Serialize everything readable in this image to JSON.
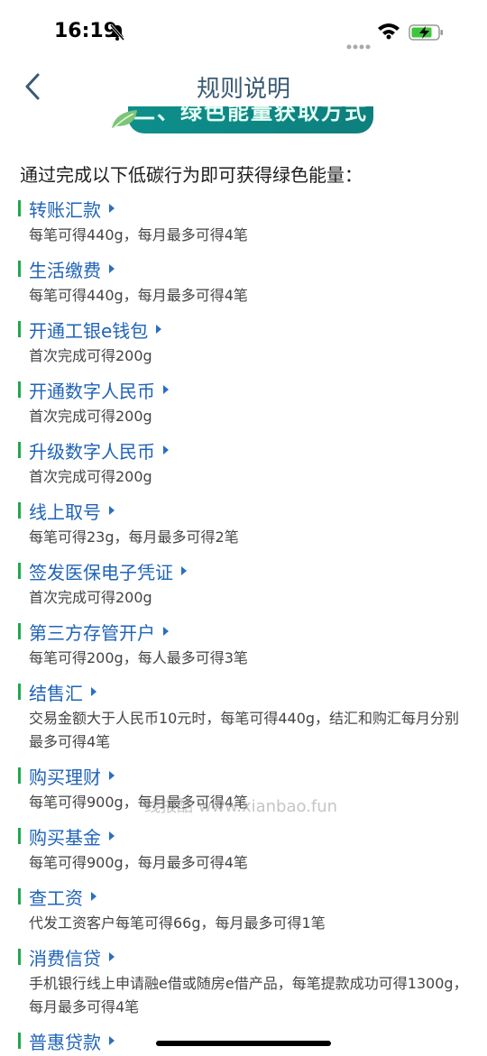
{
  "status": {
    "time": "16:19"
  },
  "nav": {
    "title": "规则说明"
  },
  "banner": {
    "text": "二、绿色能量获取方式"
  },
  "intro": "通过完成以下低碳行为即可获得绿色能量：",
  "items": [
    {
      "title": "转账汇款",
      "desc": "每笔可得440g，每月最多可得4笔"
    },
    {
      "title": "生活缴费",
      "desc": "每笔可得440g，每月最多可得4笔"
    },
    {
      "title": "开通工银e钱包",
      "desc": "首次完成可得200g"
    },
    {
      "title": "开通数字人民币",
      "desc": "首次完成可得200g"
    },
    {
      "title": "升级数字人民币",
      "desc": "首次完成可得200g"
    },
    {
      "title": "线上取号",
      "desc": "每笔可得23g，每月最多可得2笔"
    },
    {
      "title": "签发医保电子凭证",
      "desc": "首次完成可得200g"
    },
    {
      "title": "第三方存管开户",
      "desc": "每笔可得200g，每人最多可得3笔"
    },
    {
      "title": "结售汇",
      "desc": "交易金额大于人民币10元时，每笔可得440g，结汇和购汇每月分别最多可得4笔"
    },
    {
      "title": "购买理财",
      "desc": "每笔可得900g，每月最多可得4笔"
    },
    {
      "title": "购买基金",
      "desc": "每笔可得900g，每月最多可得4笔"
    },
    {
      "title": "查工资",
      "desc": "代发工资客户每笔可得66g，每月最多可得1笔"
    },
    {
      "title": "消费信贷",
      "desc": "手机银行线上申请融e借或随房e借产品，每笔提款成功可得1300g，每月最多可得4笔"
    },
    {
      "title": "普惠贷款",
      "desc": ""
    }
  ],
  "watermark": "线报酷 www.xianbao.fun",
  "colors": {
    "accent_bar": "#1ea84e",
    "link": "#1f63b8",
    "banner": "#0d8f8b"
  }
}
